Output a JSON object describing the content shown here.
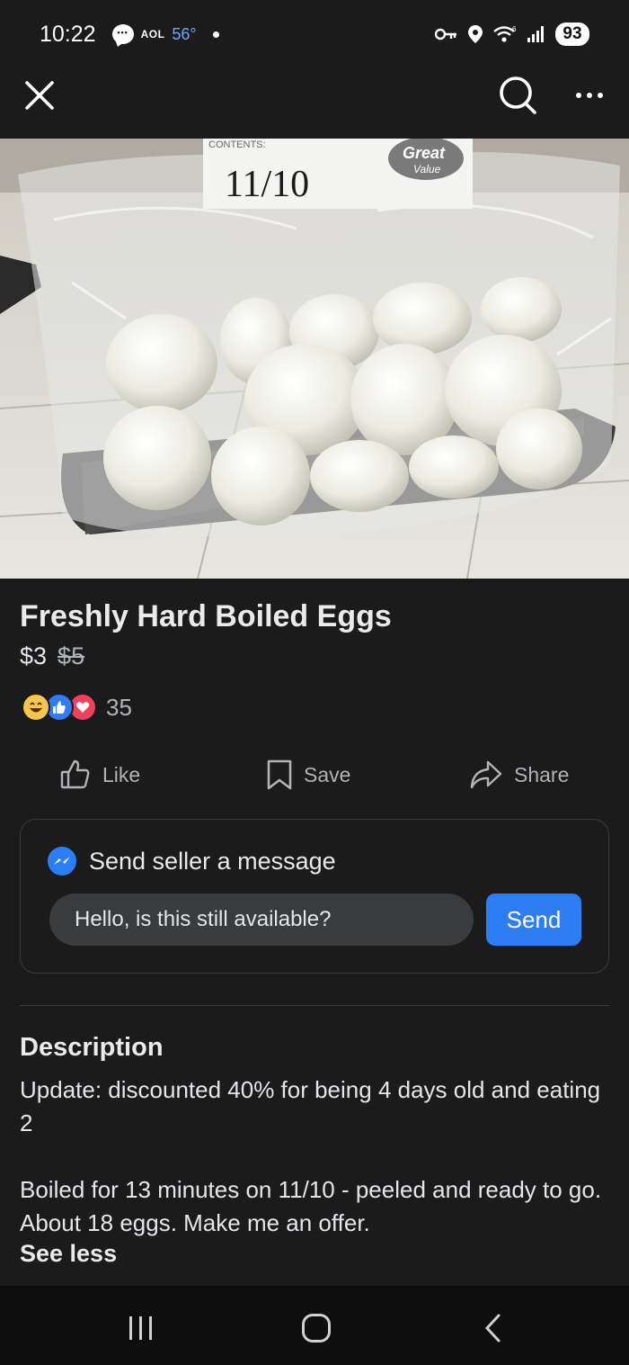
{
  "status_bar": {
    "time": "10:22",
    "notif_label": "AOL",
    "temperature": "56°",
    "battery": "93"
  },
  "listing": {
    "title": "Freshly Hard Boiled Eggs",
    "price": "$3",
    "original_price": "$5",
    "reaction_count": "35",
    "photo": {
      "label_header": "CONTENTS:",
      "label_date": "11/10",
      "brand_line1": "Great",
      "brand_line2": "Value"
    }
  },
  "actions": {
    "like_label": "Like",
    "save_label": "Save",
    "share_label": "Share"
  },
  "message": {
    "heading": "Send seller a message",
    "input_value": "Hello, is this still available?",
    "send_label": "Send"
  },
  "description": {
    "heading": "Description",
    "paragraph1": "Update: discounted 40% for being 4 days old and eating 2",
    "paragraph2": "Boiled for 13 minutes on 11/10 - peeled and ready to go. About 18 eggs. Make me an offer.",
    "toggle_label": "See less"
  },
  "colors": {
    "background": "#1b1b1c",
    "accent_blue": "#2d7ef4",
    "input_bg": "#3a3b3d"
  }
}
